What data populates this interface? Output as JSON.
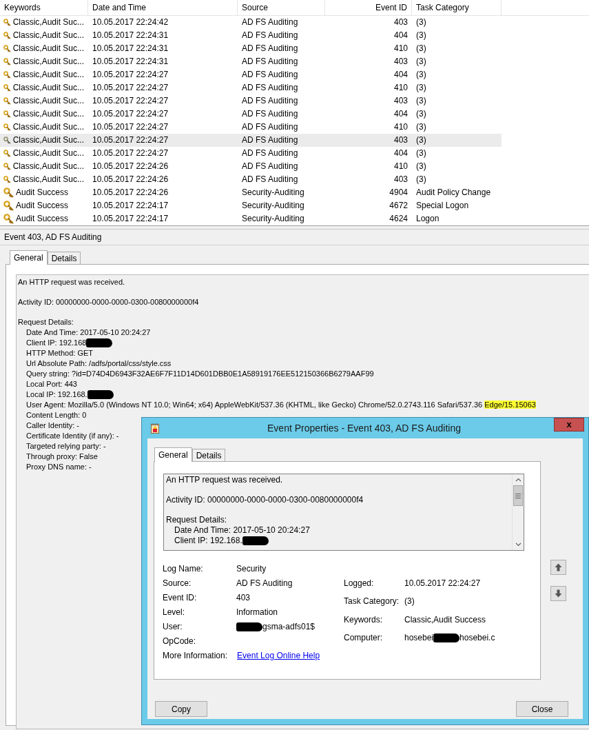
{
  "events_table": {
    "columns": [
      {
        "label": "Keywords"
      },
      {
        "label": "Date and Time"
      },
      {
        "label": "Source"
      },
      {
        "label": "Event ID"
      },
      {
        "label": "Task Category"
      }
    ],
    "rows": [
      {
        "keywords": "Classic,Audit Suc...",
        "date_time": "10.05.2017 22:24:42",
        "source": "AD FS Auditing",
        "event_id": "403",
        "task_category": "(3)",
        "selected": false
      },
      {
        "keywords": "Classic,Audit Suc...",
        "date_time": "10.05.2017 22:24:31",
        "source": "AD FS Auditing",
        "event_id": "404",
        "task_category": "(3)",
        "selected": false
      },
      {
        "keywords": "Classic,Audit Suc...",
        "date_time": "10.05.2017 22:24:31",
        "source": "AD FS Auditing",
        "event_id": "410",
        "task_category": "(3)",
        "selected": false
      },
      {
        "keywords": "Classic,Audit Suc...",
        "date_time": "10.05.2017 22:24:31",
        "source": "AD FS Auditing",
        "event_id": "403",
        "task_category": "(3)",
        "selected": false
      },
      {
        "keywords": "Classic,Audit Suc...",
        "date_time": "10.05.2017 22:24:27",
        "source": "AD FS Auditing",
        "event_id": "404",
        "task_category": "(3)",
        "selected": false
      },
      {
        "keywords": "Classic,Audit Suc...",
        "date_time": "10.05.2017 22:24:27",
        "source": "AD FS Auditing",
        "event_id": "410",
        "task_category": "(3)",
        "selected": false
      },
      {
        "keywords": "Classic,Audit Suc...",
        "date_time": "10.05.2017 22:24:27",
        "source": "AD FS Auditing",
        "event_id": "403",
        "task_category": "(3)",
        "selected": false
      },
      {
        "keywords": "Classic,Audit Suc...",
        "date_time": "10.05.2017 22:24:27",
        "source": "AD FS Auditing",
        "event_id": "404",
        "task_category": "(3)",
        "selected": false
      },
      {
        "keywords": "Classic,Audit Suc...",
        "date_time": "10.05.2017 22:24:27",
        "source": "AD FS Auditing",
        "event_id": "410",
        "task_category": "(3)",
        "selected": false
      },
      {
        "keywords": "Classic,Audit Suc...",
        "date_time": "10.05.2017 22:24:27",
        "source": "AD FS Auditing",
        "event_id": "403",
        "task_category": "(3)",
        "selected": true
      },
      {
        "keywords": "Classic,Audit Suc...",
        "date_time": "10.05.2017 22:24:27",
        "source": "AD FS Auditing",
        "event_id": "404",
        "task_category": "(3)",
        "selected": false
      },
      {
        "keywords": "Classic,Audit Suc...",
        "date_time": "10.05.2017 22:24:26",
        "source": "AD FS Auditing",
        "event_id": "410",
        "task_category": "(3)",
        "selected": false
      },
      {
        "keywords": "Classic,Audit Suc...",
        "date_time": "10.05.2017 22:24:26",
        "source": "AD FS Auditing",
        "event_id": "403",
        "task_category": "(3)",
        "selected": false
      },
      {
        "keywords": "Audit Success",
        "date_time": "10.05.2017 22:24:26",
        "source": "Security-Auditing",
        "event_id": "4904",
        "task_category": "Audit Policy Change",
        "selected": false
      },
      {
        "keywords": "Audit Success",
        "date_time": "10.05.2017 22:24:17",
        "source": "Security-Auditing",
        "event_id": "4672",
        "task_category": "Special Logon",
        "selected": false
      },
      {
        "keywords": "Audit Success",
        "date_time": "10.05.2017 22:24:17",
        "source": "Security-Auditing",
        "event_id": "4624",
        "task_category": "Logon",
        "selected": false
      }
    ]
  },
  "detail_pane": {
    "title": "Event 403, AD FS Auditing",
    "tabs": [
      {
        "label": "General",
        "selected": true
      },
      {
        "label": "Details",
        "selected": false
      }
    ],
    "paragraphs": [
      {
        "parts": [
          {
            "kind": "text",
            "text": "An HTTP request was received."
          }
        ]
      },
      {
        "parts": [
          {
            "kind": "text",
            "text": "Activity ID: 00000000-0000-0000-0300-0080000000f4"
          }
        ]
      },
      {
        "parts": [
          {
            "kind": "text",
            "text": "Request Details:"
          }
        ],
        "children": [
          {
            "parts": [
              {
                "kind": "text",
                "text": "Date And Time: 2017-05-10 20:24:27"
              }
            ]
          },
          {
            "parts": [
              {
                "kind": "text",
                "text": "Client IP: 192.168"
              },
              {
                "kind": "redaction"
              }
            ]
          },
          {
            "parts": [
              {
                "kind": "text",
                "text": "HTTP Method: GET"
              }
            ]
          },
          {
            "parts": [
              {
                "kind": "text",
                "text": "Url Absolute Path: /adfs/portal/css/style.css"
              }
            ]
          },
          {
            "parts": [
              {
                "kind": "text",
                "text": "Query string: ?id=D74D4D6943F32AE6F7F11D14D601DBB0E1A58919176EE512150366B6279AAF99"
              }
            ]
          },
          {
            "parts": [
              {
                "kind": "text",
                "text": "Local Port: 443"
              }
            ]
          },
          {
            "parts": [
              {
                "kind": "text",
                "text": "Local IP: 192.168."
              },
              {
                "kind": "redaction"
              }
            ]
          },
          {
            "parts": [
              {
                "kind": "text",
                "text": "User Agent: Mozilla/5.0 (Windows NT 10.0; Win64; x64) AppleWebKit/537.36 (KHTML, like Gecko) Chrome/52.0.2743.116 Safari/537.36 "
              },
              {
                "kind": "highlight",
                "text": "Edge/15.15063"
              }
            ]
          },
          {
            "parts": [
              {
                "kind": "text",
                "text": "Content Length: 0"
              }
            ]
          },
          {
            "parts": [
              {
                "kind": "text",
                "text": "Caller Identity: -"
              }
            ]
          },
          {
            "parts": [
              {
                "kind": "text",
                "text": "Certificate Identity (if any): -"
              }
            ]
          },
          {
            "parts": [
              {
                "kind": "text",
                "text": "Targeted relying party: -"
              }
            ]
          },
          {
            "parts": [
              {
                "kind": "text",
                "text": "Through proxy: False"
              }
            ]
          },
          {
            "parts": [
              {
                "kind": "text",
                "text": "Proxy DNS name: -"
              }
            ]
          }
        ]
      }
    ]
  },
  "dialog": {
    "title": "Event Properties - Event 403, AD FS Auditing",
    "close_glyph": "x",
    "tabs": [
      {
        "label": "General",
        "selected": true
      },
      {
        "label": "Details",
        "selected": false
      }
    ],
    "paragraphs": [
      {
        "parts": [
          {
            "kind": "text",
            "text": "An HTTP request was received."
          }
        ]
      },
      {
        "parts": [
          {
            "kind": "text",
            "text": "Activity ID: 00000000-0000-0000-0300-0080000000f4"
          }
        ]
      },
      {
        "parts": [
          {
            "kind": "text",
            "text": "Request Details:"
          }
        ],
        "children": [
          {
            "parts": [
              {
                "kind": "text",
                "text": "Date And Time: 2017-05-10 20:24:27"
              }
            ]
          },
          {
            "parts": [
              {
                "kind": "text",
                "text": "Client IP: 192.168."
              },
              {
                "kind": "redaction"
              }
            ]
          }
        ]
      }
    ],
    "fields_left": [
      {
        "label": "Log Name:",
        "value": [
          {
            "kind": "text",
            "text": "Security"
          }
        ]
      },
      {
        "label": "Source:",
        "value": [
          {
            "kind": "text",
            "text": "AD FS Auditing"
          }
        ]
      },
      {
        "label": "Event ID:",
        "value": [
          {
            "kind": "text",
            "text": "403"
          }
        ]
      },
      {
        "label": "Level:",
        "value": [
          {
            "kind": "text",
            "text": "Information"
          }
        ]
      },
      {
        "label": "User:",
        "value": [
          {
            "kind": "redaction"
          },
          {
            "kind": "text",
            "text": "gsma-adfs01$"
          }
        ]
      },
      {
        "label": "OpCode:"
      }
    ],
    "fields_right": [
      {
        "label": "Logged:",
        "value": [
          {
            "kind": "text",
            "text": "10.05.2017 22:24:27"
          }
        ]
      },
      {
        "label": "Task Category:",
        "value": [
          {
            "kind": "text",
            "text": "(3)"
          }
        ]
      },
      {
        "label": "Keywords:",
        "value": [
          {
            "kind": "text",
            "text": "Classic,Audit Success"
          }
        ]
      },
      {
        "label": "Computer:",
        "value": [
          {
            "kind": "text",
            "text": "hosebei"
          },
          {
            "kind": "redaction"
          },
          {
            "kind": "text",
            "text": "hosebei.c"
          }
        ]
      }
    ],
    "more_information": {
      "label": "More Information:",
      "link": "Event Log Online Help"
    },
    "buttons": [
      {
        "label": "Copy"
      },
      {
        "label": "Close"
      }
    ]
  }
}
